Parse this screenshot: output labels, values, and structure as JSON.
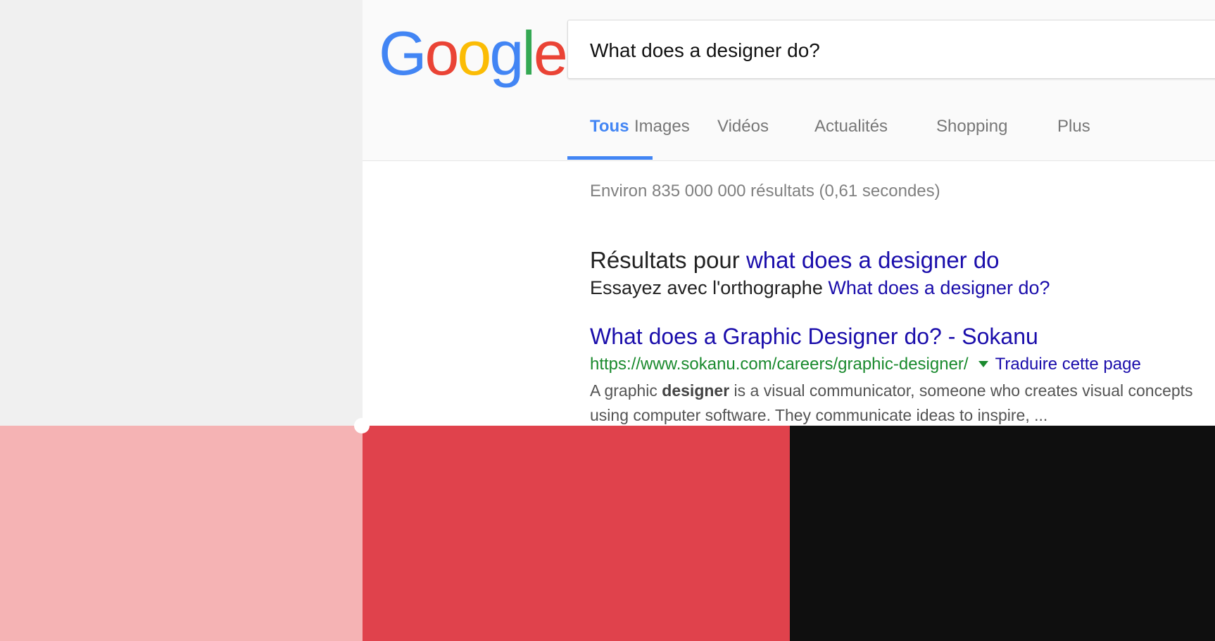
{
  "logo": {
    "letters": [
      "G",
      "o",
      "o",
      "g",
      "l",
      "e"
    ],
    "colors": [
      "#4285f4",
      "#ea4335",
      "#fbbc05",
      "#4285f4",
      "#34a853",
      "#ea4335"
    ]
  },
  "search": {
    "query": "What does a designer do?"
  },
  "tabs": [
    {
      "label": "Tous",
      "active": true
    },
    {
      "label": "Images"
    },
    {
      "label": "Vidéos"
    },
    {
      "label": "Actualités"
    },
    {
      "label": "Shopping"
    },
    {
      "label": "Plus"
    }
  ],
  "stats": "Environ 835 000 000 résultats (0,61 secondes)",
  "correction": {
    "prefix": "Résultats pour ",
    "corrected_query": "what does a designer do",
    "try_prefix": "Essayez avec l'orthographe ",
    "original_query": "What does a designer do?"
  },
  "result": {
    "title": "What does a Graphic Designer do? - Sokanu",
    "url": "https://www.sokanu.com/careers/graphic-designer/",
    "translate": "Traduire cette page",
    "snippet_prefix": "A graphic ",
    "snippet_bold": "designer",
    "snippet_rest": " is a visual communicator, someone who creates visual concepts",
    "snippet_line2": "using computer software. They communicate ideas to inspire, ..."
  },
  "palette": [
    "#f5b3b4",
    "#e0424c",
    "#0f0f0f"
  ],
  "colors": {
    "accent": "#4285f4",
    "link": "#1a0dab",
    "url": "#1a8a2e"
  }
}
